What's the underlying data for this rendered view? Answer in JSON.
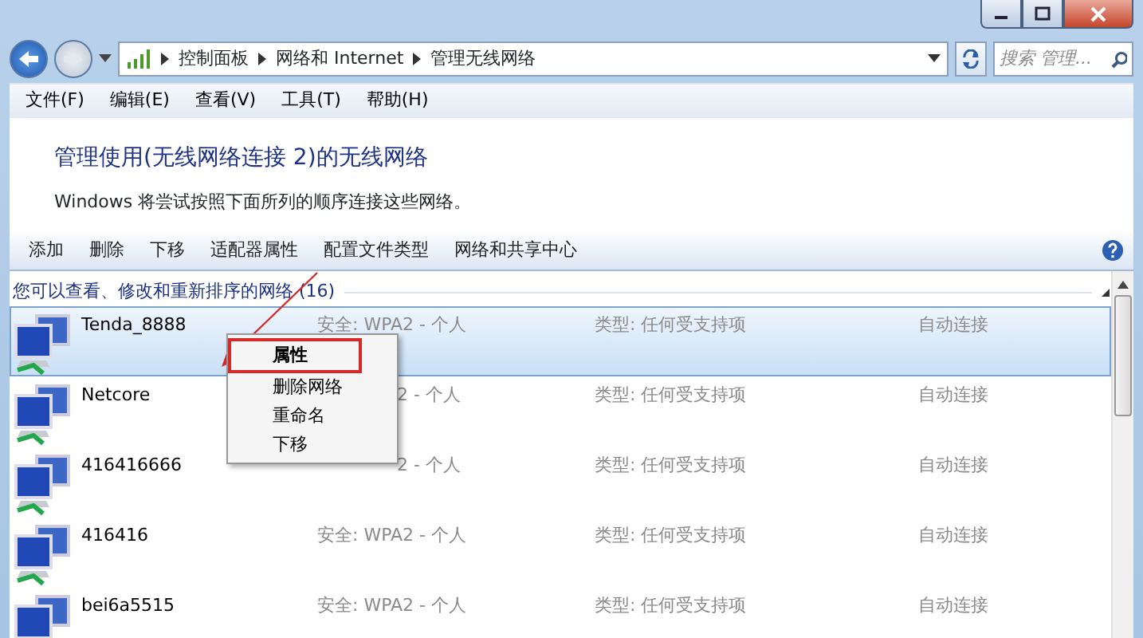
{
  "address_bar": {
    "breadcrumbs": [
      "控制面板",
      "网络和 Internet",
      "管理无线网络"
    ]
  },
  "search": {
    "placeholder": "搜索 管理..."
  },
  "menu_bar": [
    "文件(F)",
    "编辑(E)",
    "查看(V)",
    "工具(T)",
    "帮助(H)"
  ],
  "heading": "管理使用(无线网络连接 2)的无线网络",
  "description": "Windows 将尝试按照下面所列的顺序连接这些网络。",
  "toolbar": [
    "添加",
    "删除",
    "下移",
    "适配器属性",
    "配置文件类型",
    "网络和共享中心"
  ],
  "group_header": "您可以查看、修改和重新排序的网络 (16)",
  "networks": [
    {
      "name": "Tenda_8888",
      "security": "安全: WPA2 - 个人",
      "type": "类型: 任何受支持项",
      "connection": "自动连接",
      "selected": true
    },
    {
      "name": "Netcore",
      "security": "2 - 个人",
      "type": "类型: 任何受支持项",
      "connection": "自动连接",
      "selected": false
    },
    {
      "name": "416416666",
      "security": "2 - 个人",
      "type": "类型: 任何受支持项",
      "connection": "自动连接",
      "selected": false
    },
    {
      "name": "416416",
      "security": "安全: WPA2 - 个人",
      "type": "类型: 任何受支持项",
      "connection": "自动连接",
      "selected": false
    },
    {
      "name": "bei6a5515",
      "security": "安全: WPA2 - 个人",
      "type": "类型: 任何受支持项",
      "connection": "自动连接",
      "selected": false
    }
  ],
  "context_menu": [
    {
      "label": "属性",
      "highlighted": true
    },
    {
      "label": "删除网络",
      "highlighted": false
    },
    {
      "label": "重命名",
      "highlighted": false
    },
    {
      "label": "下移",
      "highlighted": false
    }
  ]
}
